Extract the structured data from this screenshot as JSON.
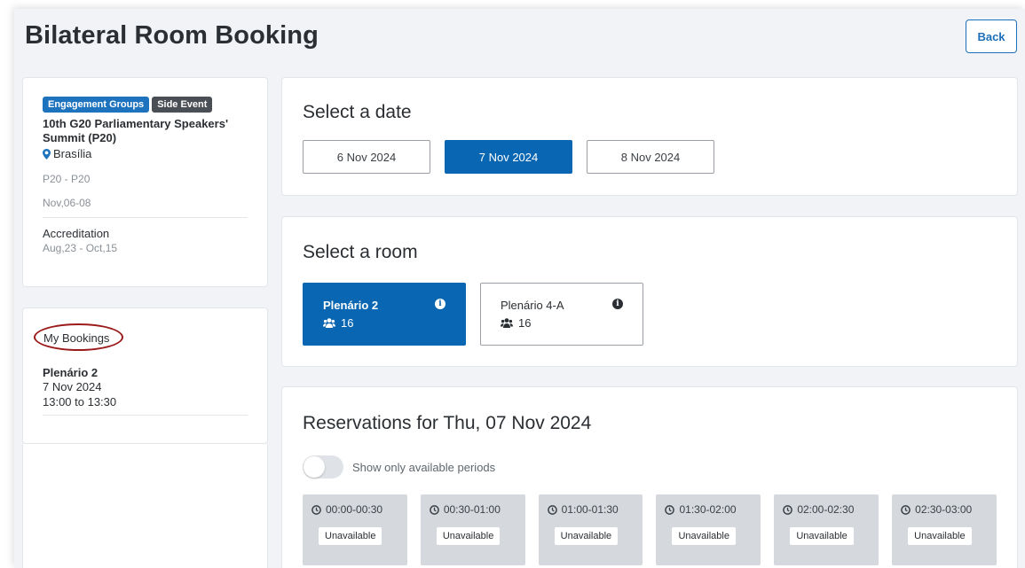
{
  "header": {
    "title": "Bilateral Room Booking",
    "back_label": "Back"
  },
  "event": {
    "badges": [
      "Engagement Groups",
      "Side Event"
    ],
    "name": "10th G20 Parliamentary Speakers' Summit (P20)",
    "location": "Brasília",
    "code": "P20 - P20",
    "dates": "Nov,06-08",
    "accreditation_label": "Accreditation",
    "accreditation_dates": "Aug,23 - Oct,15"
  },
  "bookings": {
    "title": "My Bookings",
    "items": [
      {
        "room": "Plenário 2",
        "date": "7 Nov 2024",
        "time": "13:00 to 13:30"
      }
    ]
  },
  "date_select": {
    "title": "Select a date",
    "dates": [
      "6 Nov 2024",
      "7 Nov 2024",
      "8 Nov 2024"
    ],
    "selected": "7 Nov 2024"
  },
  "room_select": {
    "title": "Select a room",
    "rooms": [
      {
        "name": "Plenário 2",
        "capacity": "16"
      },
      {
        "name": "Plenário 4-A",
        "capacity": "16"
      }
    ],
    "selected": "Plenário 2"
  },
  "reservations": {
    "title": "Reservations for Thu, 07 Nov 2024",
    "toggle_label": "Show only available periods",
    "slots": [
      {
        "time": "00:00-00:30",
        "status": "Unavailable"
      },
      {
        "time": "00:30-01:00",
        "status": "Unavailable"
      },
      {
        "time": "01:00-01:30",
        "status": "Unavailable"
      },
      {
        "time": "01:30-02:00",
        "status": "Unavailable"
      },
      {
        "time": "02:00-02:30",
        "status": "Unavailable"
      },
      {
        "time": "02:30-03:00",
        "status": "Unavailable"
      }
    ]
  },
  "colors": {
    "primary": "#0866b2",
    "annotation_circle": "#9b1b1b"
  }
}
